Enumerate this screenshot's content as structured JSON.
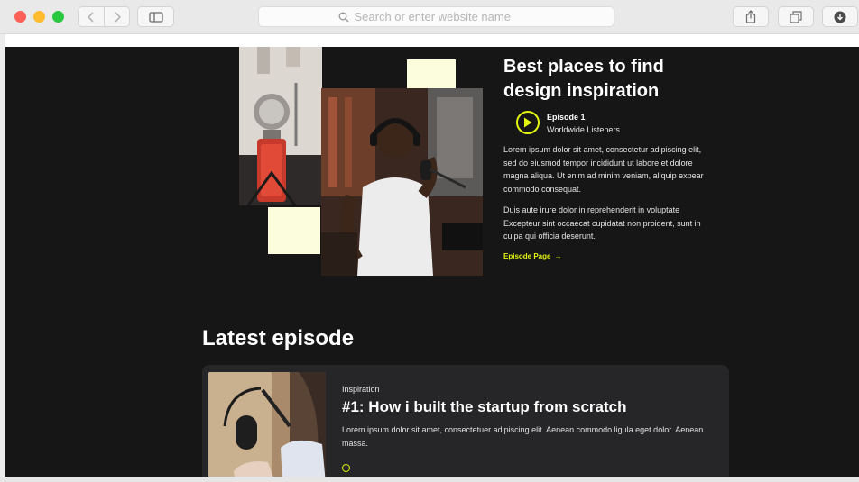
{
  "browser": {
    "address_placeholder": "Search or enter website name",
    "icons": [
      "back-chevron-icon",
      "forward-chevron-icon",
      "sidebar-icon",
      "search-icon",
      "share-icon",
      "tabs-icon",
      "download-icon"
    ]
  },
  "hero": {
    "title": "Best places to find design inspiration",
    "episode_label": "Episode 1",
    "listeners_label": "Worldwide Listeners",
    "paragraph_1": "Lorem ipsum dolor sit amet, consectetur adipiscing elit, sed do eiusmod tempor incididunt ut labore et dolore magna aliqua. Ut enim ad minim veniam, aliquip expear commodo consequat.",
    "paragraph_2": "Duis aute irure dolor in reprehenderit in voluptate Excepteur sint occaecat cupidatat non proident, sunt in culpa qui officia deserunt.",
    "link_label": "Episode Page",
    "link_arrow": "→"
  },
  "latest": {
    "heading": "Latest episode",
    "card": {
      "category": "Inspiration",
      "title": "#1: How i built the startup from scratch",
      "description": "Lorem ipsum dolor sit amet, consectetuer adipiscing elit. Aenean commodo ligula eget dolor. Aenean massa."
    }
  },
  "colors": {
    "accent": "#e3f50e",
    "page_background": "#161616",
    "card_background": "#262628",
    "sticky_note": "#fbfddc"
  }
}
